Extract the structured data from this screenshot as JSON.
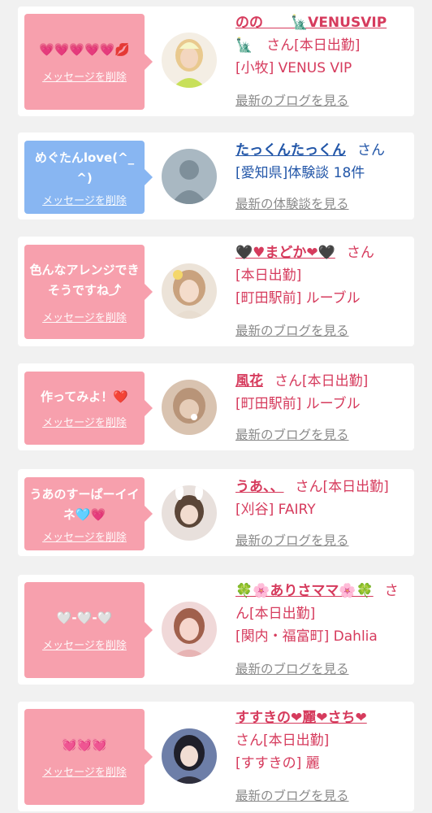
{
  "delete_label": "メッセージを削除",
  "items": [
    {
      "message": "💗💗💗💗💗💋",
      "bubble_color": "#f7a0ad",
      "avatar_icon": "avatar-blonde-girl",
      "name": "のの　　🗽VENUSVIP",
      "name_suffix": "🗽　さん[本日出勤]",
      "shop": "[小牧] VENUS VIP",
      "link": "最新のブログを見る"
    },
    {
      "message": "めぐたんlove(^_^)",
      "bubble_color": "#88b6f2",
      "avatar_icon": "avatar-no-photo",
      "name": "たっくんたっくん",
      "name_suffix": "さん",
      "shop": "[愛知県]体験談 18件",
      "link": "最新の体験談を見る",
      "no_photo": "no photo"
    },
    {
      "message": "色んなアレンジできそうですね⤴",
      "bubble_color": "#f7a0ad",
      "avatar_icon": "avatar-girl-flower",
      "name": "🖤♥まどか❤🖤",
      "name_suffix": "さん",
      "status": "[本日出勤]",
      "shop": "[町田駅前] ルーブル",
      "link": "最新のブログを見る"
    },
    {
      "message": "作ってみよ！❤️",
      "bubble_color": "#f7a0ad",
      "avatar_icon": "avatar-blurred-girl",
      "name": "風花",
      "name_suffix": "さん[本日出勤]",
      "shop": "[町田駅前] ルーブル",
      "link": "最新のブログを見る"
    },
    {
      "message": "うあのすーぱーイイネ🩵💗",
      "bubble_color": "#f7a0ad",
      "avatar_icon": "avatar-girl-bunny",
      "name": "うあ、、",
      "name_suffix": "さん[本日出勤]",
      "shop": "[刈谷] FAIRY",
      "link": "最新のブログを見る"
    },
    {
      "message": "🤍-🤍-🤍",
      "bubble_color": "#f7a0ad",
      "avatar_icon": "avatar-girl-pink",
      "name": "🍀🌸ありさママ🌸🍀",
      "name_suffix": "さ",
      "name_suffix2": "ん[本日出勤]",
      "shop": "[関内・福富町] Dahlia",
      "link": "最新のブログを見る"
    },
    {
      "message": "💓💓💓",
      "bubble_color": "#f7a0ad",
      "avatar_icon": "avatar-girl-dark",
      "name": "すすきの❤麗❤さち❤",
      "name_suffix": "さん[本日出勤]",
      "shop": "[すすきの] 麗",
      "link": "最新のブログを見る"
    }
  ]
}
